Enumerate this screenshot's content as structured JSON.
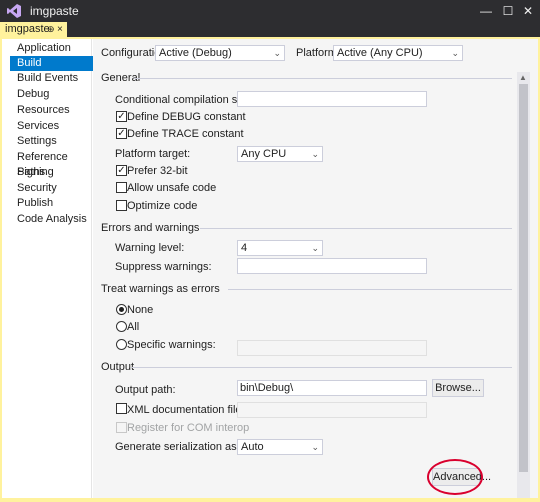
{
  "window": {
    "title": "imgpaste"
  },
  "doc_tab": {
    "label": "imgpaste",
    "pin": "⊕",
    "close": "×"
  },
  "nav": {
    "items": [
      {
        "label": "Application"
      },
      {
        "label": "Build"
      },
      {
        "label": "Build Events"
      },
      {
        "label": "Debug"
      },
      {
        "label": "Resources"
      },
      {
        "label": "Services"
      },
      {
        "label": "Settings"
      },
      {
        "label": "Reference Paths"
      },
      {
        "label": "Signing"
      },
      {
        "label": "Security"
      },
      {
        "label": "Publish"
      },
      {
        "label": "Code Analysis"
      }
    ],
    "active": "Build"
  },
  "top": {
    "configuration_label": "Configuration:",
    "configuration_value": "Active (Debug)",
    "platform_label": "Platform:",
    "platform_value": "Active (Any CPU)"
  },
  "general": {
    "header": "General",
    "conditional_label": "Conditional compilation symbols:",
    "conditional_value": "",
    "define_debug": "Define DEBUG constant",
    "define_trace": "Define TRACE constant",
    "platform_target_label": "Platform target:",
    "platform_target_value": "Any CPU",
    "prefer32": "Prefer 32-bit",
    "unsafe": "Allow unsafe code",
    "optimize": "Optimize code"
  },
  "errors": {
    "header": "Errors and warnings",
    "warning_level_label": "Warning level:",
    "warning_level_value": "4",
    "suppress_label": "Suppress warnings:",
    "suppress_value": ""
  },
  "treat": {
    "header": "Treat warnings as errors",
    "none": "None",
    "all": "All",
    "specific": "Specific warnings:",
    "specific_value": ""
  },
  "output": {
    "header": "Output",
    "output_path_label": "Output path:",
    "output_path_value": "bin\\Debug\\",
    "browse": "Browse...",
    "xml_label": "XML documentation file:",
    "xml_value": "",
    "com_interop": "Register for COM interop",
    "serialization_label": "Generate serialization assembly:",
    "serialization_value": "Auto"
  },
  "advanced_button": "Advanced...",
  "colors": {
    "accent": "#007acc",
    "tab_highlight": "#fff29d",
    "annotation": "#d9002e"
  }
}
